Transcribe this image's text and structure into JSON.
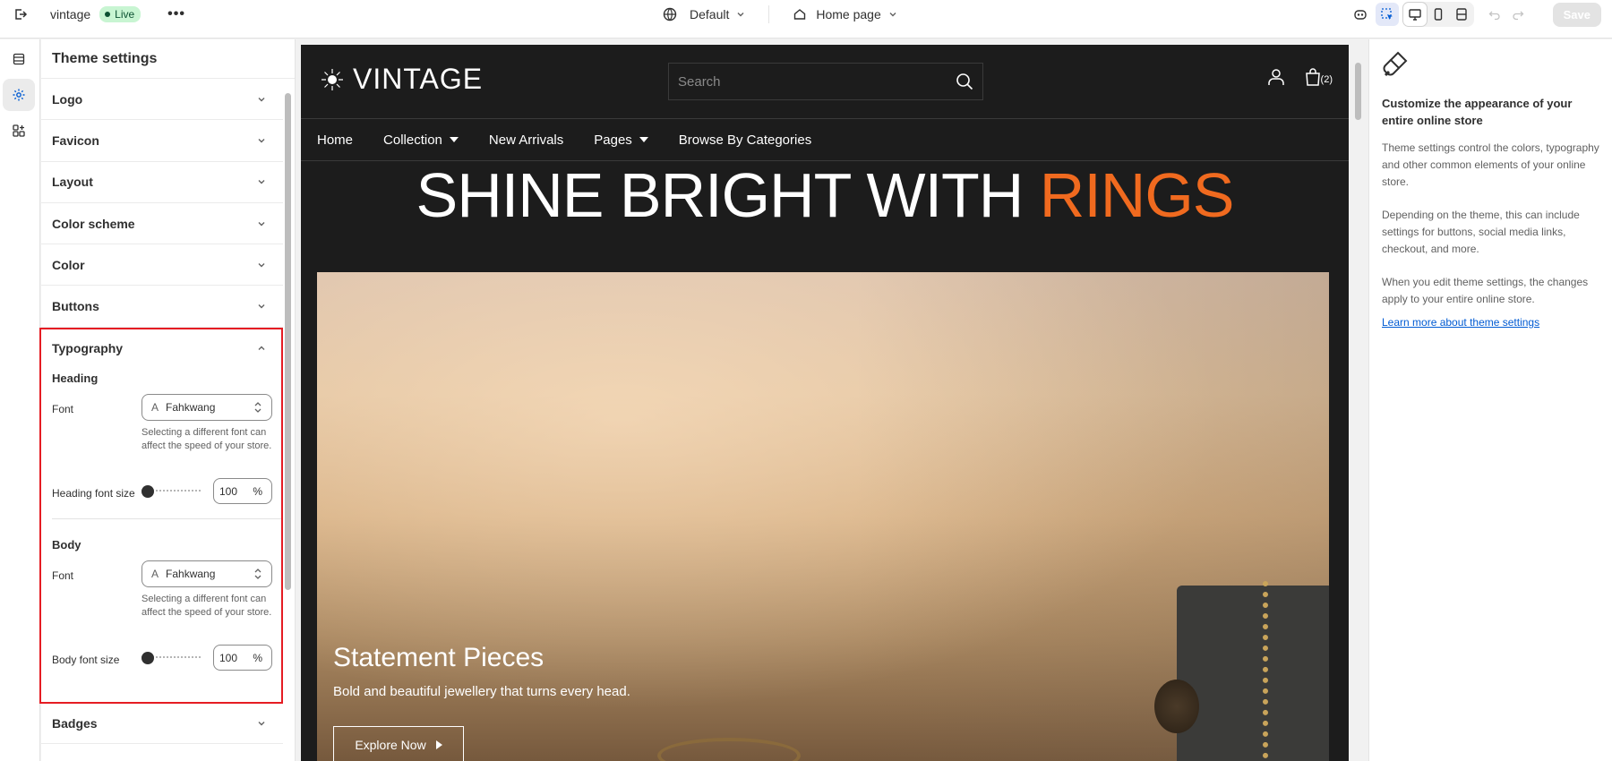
{
  "topbar": {
    "store_name": "vintage",
    "status": "Live",
    "more_label": "•••",
    "theme_label": "Default",
    "page_label": "Home page",
    "save_label": "Save"
  },
  "panel": {
    "title": "Theme settings",
    "sections": [
      "Logo",
      "Favicon",
      "Layout",
      "Color scheme",
      "Color",
      "Buttons"
    ],
    "typography": {
      "label": "Typography",
      "heading": {
        "label": "Heading",
        "font_label": "Font",
        "font_value": "Fahkwang",
        "hint": "Selecting a different font can affect the speed of your store.",
        "size_label": "Heading font size",
        "size_value": "100",
        "size_unit": "%",
        "slider_fraction": 0
      },
      "body": {
        "label": "Body",
        "font_label": "Font",
        "font_value": "Fahkwang",
        "hint": "Selecting a different font can affect the speed of your store.",
        "size_label": "Body font size",
        "size_value": "100",
        "size_unit": "%",
        "slider_fraction": 0
      }
    },
    "after_sections": [
      "Badges"
    ]
  },
  "preview": {
    "logo_text": "VINTAGE",
    "search_placeholder": "Search",
    "cart_count": "(2)",
    "nav": [
      "Home",
      "Collection",
      "New Arrivals",
      "Pages",
      "Browse By Categories"
    ],
    "hero_title_main": "SHINE BRIGHT WITH",
    "hero_title_accent": "RINGS",
    "hero_heading": "Statement Pieces",
    "hero_subheading": "Bold and beautiful jewellery that turns every head.",
    "hero_button": "Explore Now",
    "accent_color": "#f06a1f"
  },
  "help": {
    "title": "Customize the appearance of your entire online store",
    "p1": "Theme settings control the colors, typography and other common elements of your online store.",
    "p2": "Depending on the theme, this can include settings for buttons, social media links, checkout, and more.",
    "p3": "When you edit theme settings, the changes apply to your entire online store.",
    "link": "Learn more about theme settings"
  }
}
